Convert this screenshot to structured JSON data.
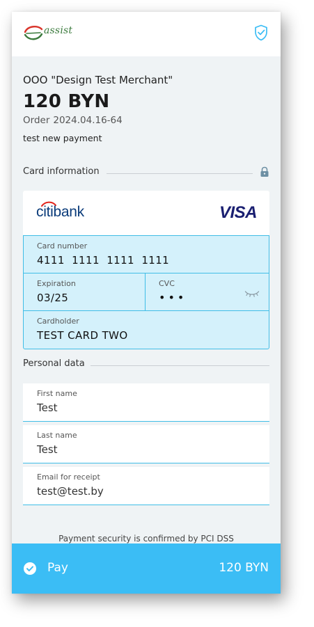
{
  "header": {
    "logo_text": "assist",
    "security_icon": "shield-check-icon"
  },
  "order": {
    "merchant": "OOO \"Design Test Merchant\"",
    "amount": "120 BYN",
    "order_label": "Order",
    "order_number": "2024.04.16-64",
    "description": "test new payment"
  },
  "card_section": {
    "title": "Card information",
    "lock_icon": "lock-icon"
  },
  "card": {
    "bank_logo": {
      "citi": "citi",
      "bank": "bank"
    },
    "network_logo": "VISA",
    "number_label": "Card number",
    "number_value": "4111  1111  1111  1111",
    "expiration_label": "Expiration",
    "expiration_value": "03/25",
    "cvc_label": "CVC",
    "cvc_value": "•••",
    "cvc_toggle_icon": "eye-closed-icon",
    "holder_label": "Cardholder",
    "holder_value": "TEST CARD TWO"
  },
  "personal_section": {
    "title": "Personal data"
  },
  "personal": {
    "first_name_label": "First name",
    "first_name_value": "Test",
    "last_name_label": "Last name",
    "last_name_value": "Test",
    "email_label": "Email for receipt",
    "email_value": "test@test.by"
  },
  "security_note": "Payment security is confirmed by PCI DSS",
  "pay": {
    "label": "Pay",
    "amount": "120 BYN",
    "icon": "check-circle-icon"
  },
  "colors": {
    "accent": "#3bbdf5",
    "field_fill": "#d4f1fb",
    "field_border": "#3fbde6",
    "background": "#eff3f5",
    "visa_blue": "#1a1f71",
    "citi_blue": "#0a3b7a",
    "citi_arc": "#e2231a"
  }
}
